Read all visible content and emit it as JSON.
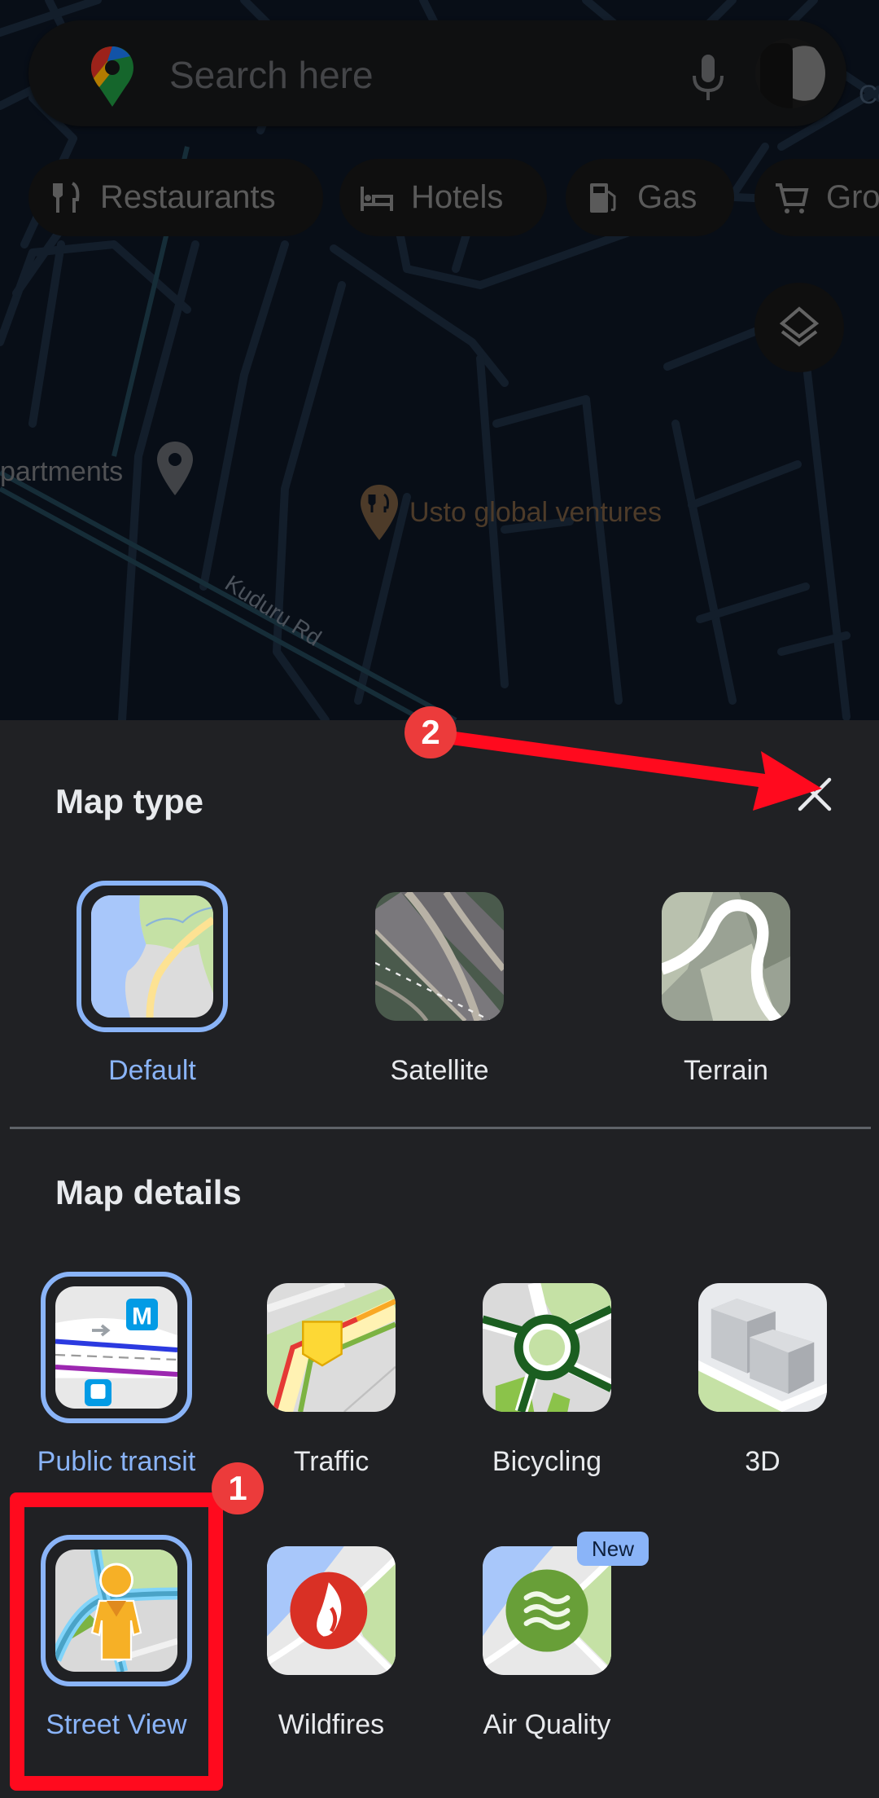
{
  "map": {
    "search": {
      "placeholder": "Search here",
      "icons": {
        "logo": "google-maps-pin-logo",
        "mic": "microphone-icon",
        "avatar": "profile-avatar"
      }
    },
    "chips": [
      {
        "label": "Restaurants",
        "icon": "fork-knife-icon"
      },
      {
        "label": "Hotels",
        "icon": "bed-icon"
      },
      {
        "label": "Gas",
        "icon": "gas-pump-icon"
      },
      {
        "label": "Gro",
        "icon": "shopping-cart-icon"
      }
    ],
    "layers_icon": "layers-icon",
    "labels": {
      "apartments": "partments",
      "poi": "Usto global ventures",
      "road": "Kuduru Rd",
      "corner": "Co"
    }
  },
  "sheet": {
    "map_type": {
      "title": "Map type",
      "close_icon": "close-icon",
      "options": [
        {
          "label": "Default",
          "selected": true
        },
        {
          "label": "Satellite",
          "selected": false
        },
        {
          "label": "Terrain",
          "selected": false
        }
      ]
    },
    "map_details": {
      "title": "Map details",
      "options": [
        {
          "label": "Public transit",
          "selected": true
        },
        {
          "label": "Traffic",
          "selected": false
        },
        {
          "label": "Bicycling",
          "selected": false
        },
        {
          "label": "3D",
          "selected": false
        },
        {
          "label": "Street View",
          "selected": true
        },
        {
          "label": "Wildfires",
          "selected": false
        },
        {
          "label": "Air Quality",
          "selected": false,
          "badge": "New"
        }
      ]
    }
  },
  "annotations": {
    "step1": "1",
    "step2": "2",
    "color": "#ff0a1e"
  },
  "colors": {
    "accent": "#8ab4f8",
    "sheet_bg": "#202124",
    "text": "#e8eaed"
  }
}
